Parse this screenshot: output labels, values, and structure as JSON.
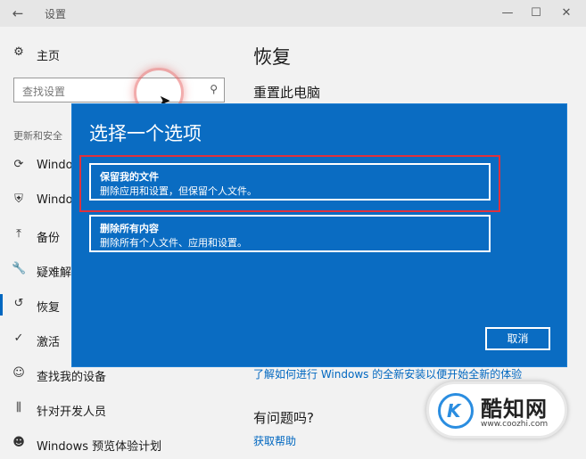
{
  "window": {
    "title": "设置",
    "back_icon": "back-arrow-icon"
  },
  "sidebar": {
    "home_label": "主页",
    "search_placeholder": "查找设置",
    "section_label": "更新和安全",
    "items": [
      {
        "label": "Windows",
        "icon": "sync-icon"
      },
      {
        "label": "Windows",
        "icon": "shield-icon"
      },
      {
        "label": "备份",
        "icon": "upload-icon"
      },
      {
        "label": "疑难解答",
        "icon": "wrench-icon"
      },
      {
        "label": "恢复",
        "icon": "history-icon",
        "active": true
      },
      {
        "label": "激活",
        "icon": "check-circle-icon"
      },
      {
        "label": "查找我的设备",
        "icon": "person-icon"
      },
      {
        "label": "针对开发人员",
        "icon": "dev-icon"
      },
      {
        "label": "Windows 预览体验计划",
        "icon": "insider-icon"
      }
    ]
  },
  "main": {
    "title": "恢复",
    "reset_heading": "重置此电脑",
    "learn_link": "了解如何进行 Windows 的全新安装以便开始全新的体验",
    "question_heading": "有问题吗?",
    "help_link": "获取帮助"
  },
  "dialog": {
    "title": "选择一个选项",
    "options": [
      {
        "title": "保留我的文件",
        "desc": "删除应用和设置，但保留个人文件。"
      },
      {
        "title": "删除所有内容",
        "desc": "删除所有个人文件、应用和设置。"
      }
    ],
    "cancel_label": "取消"
  },
  "watermark": {
    "name": "酷知网",
    "url": "www.coozhi.com",
    "logo_letter": "K"
  },
  "colors": {
    "dialog_bg": "#0a6cc2",
    "link": "#0067c0",
    "highlight": "#e0313c"
  }
}
